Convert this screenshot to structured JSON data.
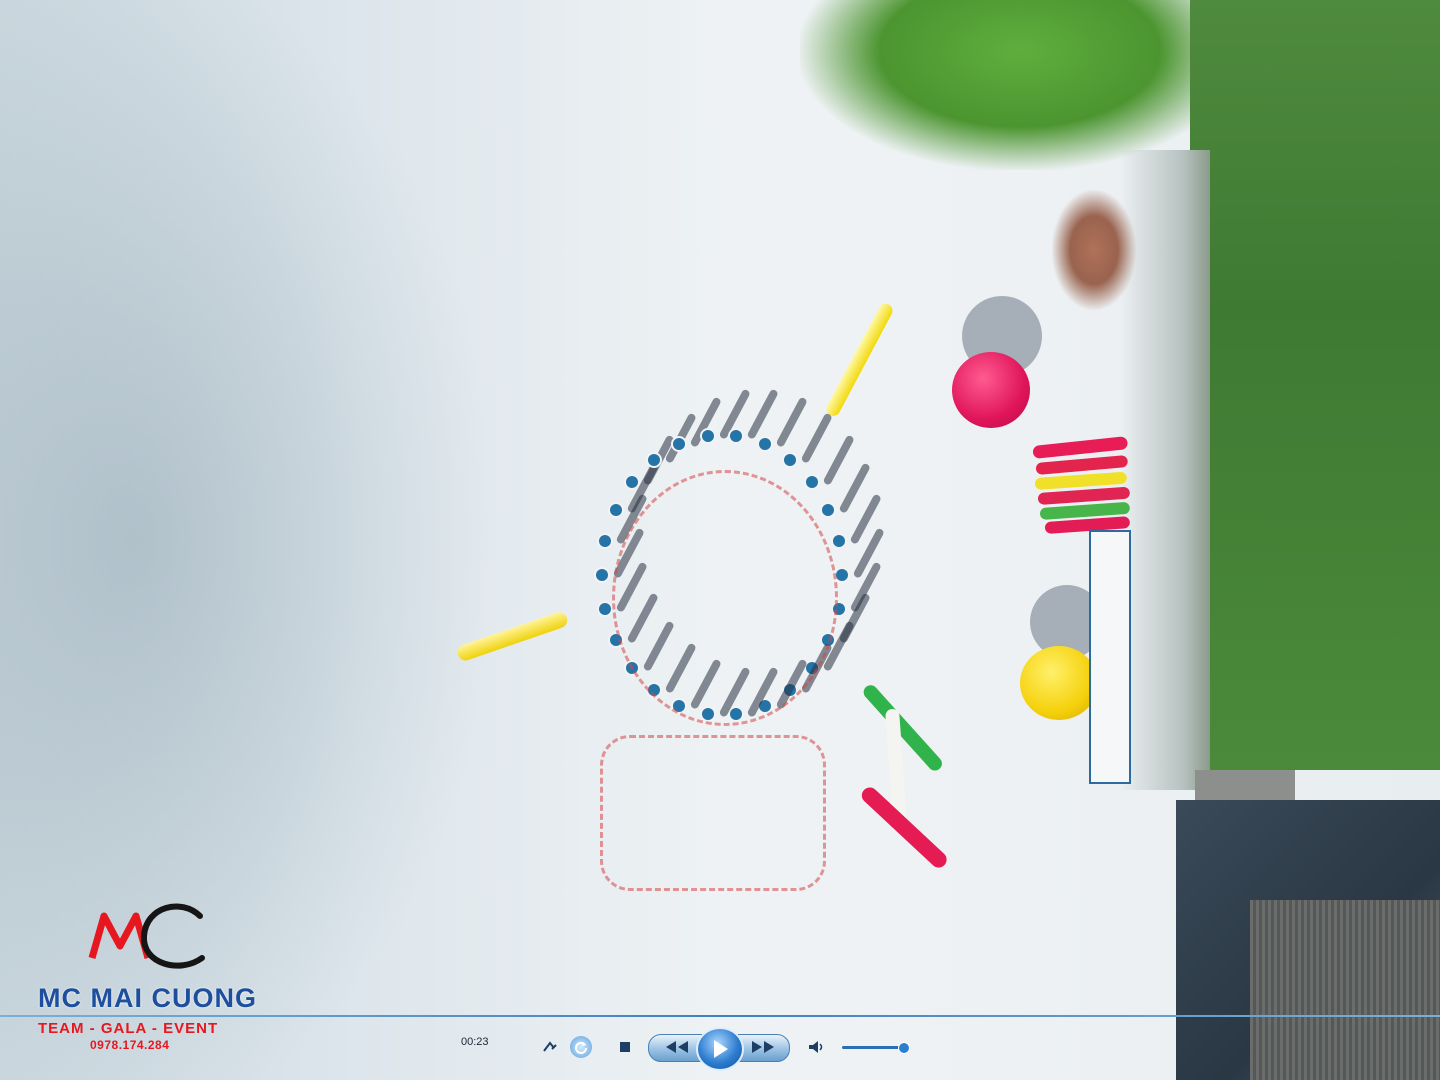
{
  "logo": {
    "title": "MC MAI CUONG",
    "subtitle": "TEAM - GALA - EVENT",
    "phone": "0978.174.284"
  },
  "player": {
    "elapsed_time": "00:23",
    "volume_level": 0.9,
    "icons": {
      "switch_view": "switch-view-icon",
      "repeat": "repeat-icon",
      "stop": "stop-icon",
      "previous": "previous-icon",
      "play": "play-icon",
      "next": "next-icon",
      "volume": "speaker-icon"
    }
  },
  "colors": {
    "sand": "#eef2f4",
    "grass": "#4b8a3a",
    "red_ball": "#e0155a",
    "yellow_ball": "#f5d10c",
    "logo_blue": "#1e4f9e",
    "logo_red": "#e6171f",
    "player_accent": "#2f7ed0"
  }
}
